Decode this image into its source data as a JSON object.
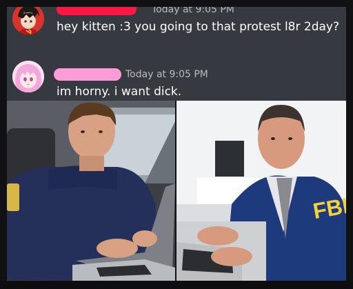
{
  "messages": [
    {
      "avatar_icon": "communist-avatar-icon",
      "username_redacted": true,
      "name_color": "#ff1744",
      "timestamp": "Today at 9:05 PM",
      "text": "hey kitten :3 you going to that protest l8r 2day?"
    },
    {
      "avatar_icon": "anime-girl-avatar-icon",
      "username_redacted": true,
      "name_color": "#ff9bd6",
      "timestamp": "Today at 9:05 PM",
      "text": "im horny. i want dick."
    }
  ],
  "photos": [
    {
      "description_icon": "police-officer-laptop-photo",
      "patch_text": ""
    },
    {
      "description_icon": "fbi-agent-laptop-photo",
      "jacket_text": "FBI"
    }
  ],
  "colors": {
    "chat_bg": "#36393f",
    "text": "#ffffff",
    "timestamp": "#b9bbbe"
  }
}
